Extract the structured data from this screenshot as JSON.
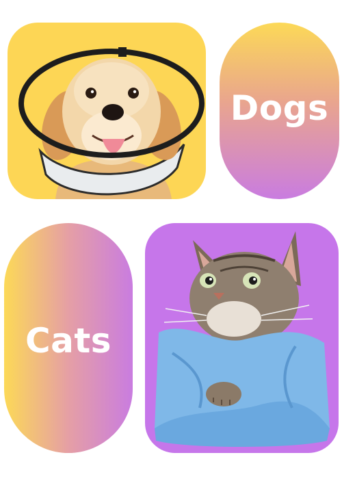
{
  "tiles": {
    "dogs": {
      "label": "Dogs"
    },
    "cats": {
      "label": "Cats"
    }
  },
  "colors": {
    "yellow": "#fdd655",
    "purple": "#c676ea",
    "white": "#ffffff"
  },
  "images": {
    "dog": "golden-retriever-with-cone-photo",
    "cat": "tabby-cat-in-blue-towel-photo"
  }
}
